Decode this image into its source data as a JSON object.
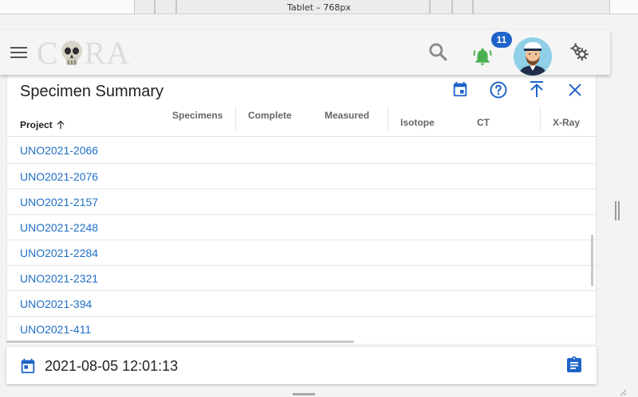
{
  "viewport": {
    "label": "Tablet – 768px"
  },
  "appbar": {
    "logo_text": "CRA",
    "notifications_count": "11",
    "icons": {
      "menu": "menu-icon",
      "search": "search-icon",
      "notifications": "bell-icon",
      "settings": "gears-icon"
    }
  },
  "card": {
    "title": "Specimen Summary",
    "actions": [
      "calendar-icon",
      "help-icon",
      "scroll-top-icon",
      "close-icon"
    ],
    "columns": [
      "Project",
      "Specimens",
      "Complete",
      "Measured",
      "Isotope",
      "CT",
      "X-Ray"
    ],
    "sorted_column": "Project",
    "sort_direction": "ascending",
    "rows": [
      "UNO2021-2066",
      "UNO2021-2076",
      "UNO2021-2157",
      "UNO2021-2248",
      "UNO2021-2284",
      "UNO2021-2321",
      "UNO2021-394",
      "UNO2021-411"
    ]
  },
  "footer": {
    "datetime": "2021-08-05 12:01:13",
    "icons": {
      "left": "calendar-icon",
      "right": "clipboard-icon"
    }
  },
  "colors": {
    "accent": "#1e63c8",
    "link": "#1f6fc5",
    "bell": "#4caf50",
    "appbar_bg": "#f5f5f5"
  }
}
